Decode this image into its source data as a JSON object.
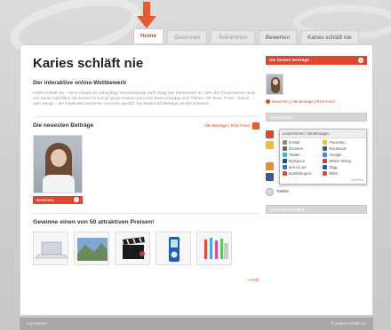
{
  "tabs": [
    {
      "label": "Home",
      "active": true
    },
    {
      "label": "Gewinnen",
      "active": false
    },
    {
      "label": "Teilnehmen",
      "active": false
    },
    {
      "label": "Bewerten",
      "active": false
    },
    {
      "label": "Karies schläft nie",
      "active": false
    }
  ],
  "main": {
    "title": "Karies schläft nie",
    "subtitle": "Der interaktive online-Wettbewerb",
    "intro": "Karies schläft nie – denn sobald die Zahnpflege vernachlässigt wird, steigt das Kariesrisiko an. 90% der Erwachsenen sind von Karies betroffen! Sei kreativ im Kampf gegen Karies und poste deine Einträge zum Thema. Ob Texte, Fotos, Videos oder Songs – der Kreativität sind keine Grenzen gesetzt. Die besten 50 Beiträge werden prämiert.",
    "latest_title": "Die neuesten Beiträge",
    "latest_links": "Alle Beiträge | RSS-Feed",
    "vote_label": "Bewerten",
    "prizes_title": "Gewinne einen von 50 attraktiven Preisen!",
    "more_label": "» mehr"
  },
  "sidebar": {
    "best_title": "Die besten Beiträge",
    "best_links": "Bewerten | Alle Beiträge | RSS-Feed",
    "weitersagen_label": "Weitersagen",
    "share_popup_head": "Lesezeichen / Weitersagen",
    "share_items": [
      {
        "label": "E-Mail",
        "color": "#8a8a8a"
      },
      {
        "label": "Favoriten",
        "color": "#f0c030"
      },
      {
        "label": "Drucken",
        "color": "#666666"
      },
      {
        "label": "Facebook",
        "color": "#3b5998"
      },
      {
        "label": "Twitter",
        "color": "#33b5e5"
      },
      {
        "label": "Google",
        "color": "#4a86e8"
      },
      {
        "label": "MySpace",
        "color": "#1d4f91"
      },
      {
        "label": "Mister Wong",
        "color": "#d33b2c"
      },
      {
        "label": "deli.cio.us",
        "color": "#3274d1"
      },
      {
        "label": "Digg",
        "color": "#2a5a8a"
      },
      {
        "label": "stumbleupon",
        "color": "#eb4924"
      },
      {
        "label": "Mehr",
        "color": "#e0462f"
      }
    ],
    "share_footer": "AddThis",
    "twitter_label": "Twitter",
    "ambassador_label": "Produktbotschafter"
  },
  "footer": {
    "left": "Impressum",
    "right": "© Karies schläft nie"
  },
  "colors": {
    "accent": "#e0462f",
    "bg": "#d9d9d9"
  }
}
